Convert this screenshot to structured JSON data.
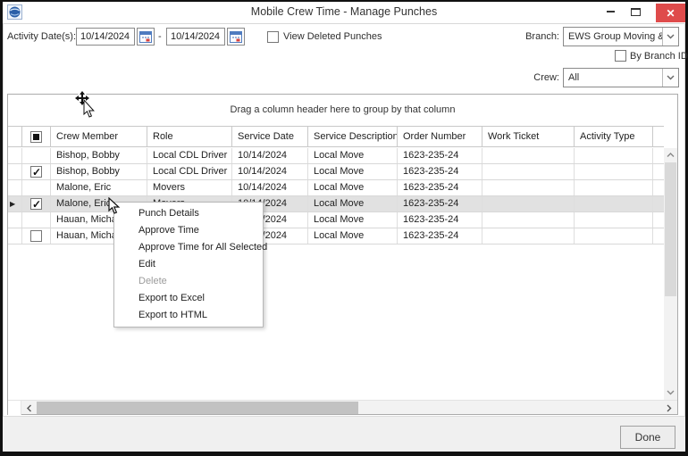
{
  "window": {
    "title": "Mobile Crew Time - Manage Punches"
  },
  "filters": {
    "activity_date_label": "Activity Date(s):",
    "date_from": "10/14/2024",
    "date_separator": "-",
    "date_to": "10/14/2024",
    "view_deleted_label": "View Deleted Punches",
    "branch_label": "Branch:",
    "branch_value": "EWS Group Moving & Stor",
    "by_branch_id_label": "By Branch ID",
    "crew_label": "Crew:",
    "crew_value": "All"
  },
  "grid": {
    "group_by_hint": "Drag a column header here to group by that column",
    "select_all_state": "indeterminate",
    "columns": [
      "Crew Member",
      "Role",
      "Service Date",
      "Service Description",
      "Order Number",
      "Work Ticket",
      "Activity Type"
    ],
    "rows": [
      {
        "checkbox": "none",
        "indicator": false,
        "selected": false,
        "cells": {
          "crew_member": "Bishop, Bobby",
          "role": "Local CDL Driver",
          "service_date": "10/14/2024",
          "service_description": "Local Move",
          "order_number": "1623-235-24",
          "work_ticket": "",
          "activity_type": ""
        }
      },
      {
        "checkbox": "checked",
        "indicator": false,
        "selected": false,
        "cells": {
          "crew_member": "Bishop, Bobby",
          "role": "Local CDL Driver",
          "service_date": "10/14/2024",
          "service_description": "Local Move",
          "order_number": "1623-235-24",
          "work_ticket": "",
          "activity_type": ""
        }
      },
      {
        "checkbox": "none",
        "indicator": false,
        "selected": false,
        "cells": {
          "crew_member": "Malone, Eric",
          "role": "Movers",
          "service_date": "10/14/2024",
          "service_description": "Local Move",
          "order_number": "1623-235-24",
          "work_ticket": "",
          "activity_type": ""
        }
      },
      {
        "checkbox": "checked",
        "indicator": true,
        "selected": true,
        "cells": {
          "crew_member": "Malone, Eric",
          "role": "Movers",
          "service_date": "10/14/2024",
          "service_description": "Local Move",
          "order_number": "1623-235-24",
          "work_ticket": "",
          "activity_type": ""
        }
      },
      {
        "checkbox": "none",
        "indicator": false,
        "selected": false,
        "cells": {
          "crew_member": "Hauan, Micha",
          "role": "",
          "service_date": "10/14/2024",
          "service_description": "Local Move",
          "order_number": "1623-235-24",
          "work_ticket": "",
          "activity_type": ""
        }
      },
      {
        "checkbox": "unchecked",
        "indicator": false,
        "selected": false,
        "cells": {
          "crew_member": "Hauan, Micha",
          "role": "",
          "service_date": "10/14/2024",
          "service_description": "Local Move",
          "order_number": "1623-235-24",
          "work_ticket": "",
          "activity_type": ""
        }
      }
    ]
  },
  "context_menu": {
    "items": [
      {
        "label": "Punch Details",
        "enabled": true
      },
      {
        "label": "Approve Time",
        "enabled": true
      },
      {
        "label": "Approve Time for All Selected",
        "enabled": true
      },
      {
        "label": "Edit",
        "enabled": true
      },
      {
        "label": "Delete",
        "enabled": false
      },
      {
        "label": "Export to Excel",
        "enabled": true
      },
      {
        "label": "Export to HTML",
        "enabled": true
      }
    ]
  },
  "footer": {
    "done_label": "Done"
  }
}
